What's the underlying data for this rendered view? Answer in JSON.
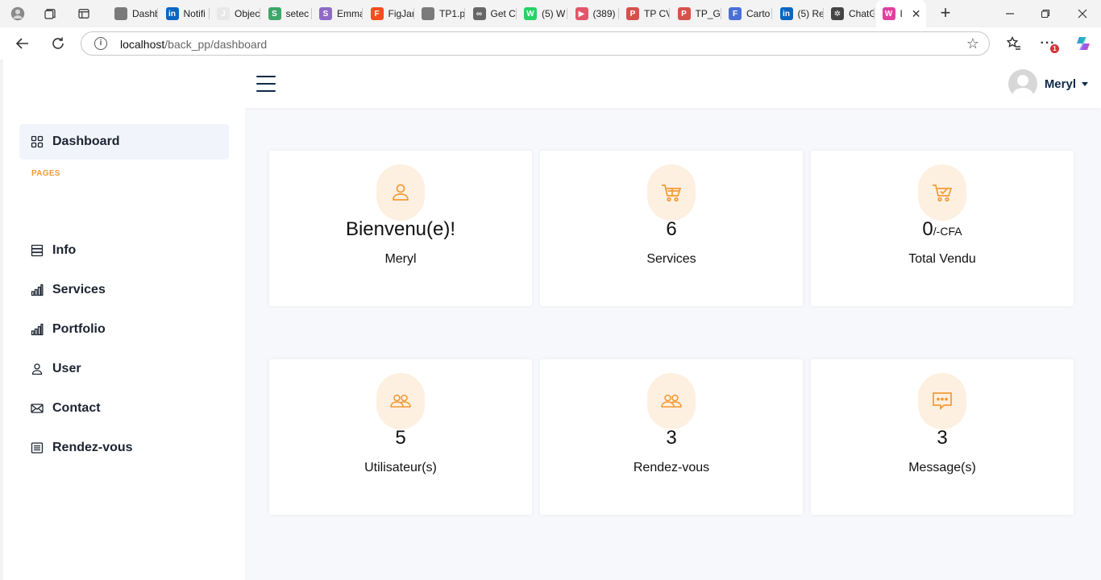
{
  "browser": {
    "tabs": [
      {
        "title": "Dashb",
        "color": "#7a7a7a",
        "glyph": ""
      },
      {
        "title": "Notifi",
        "color": "#0a66c2",
        "glyph": "in"
      },
      {
        "title": "Objec",
        "color": "#e8e8e8",
        "glyph": "J"
      },
      {
        "title": "setec",
        "color": "#3fa66a",
        "glyph": "S"
      },
      {
        "title": "Emma",
        "color": "#8e6ac6",
        "glyph": "S"
      },
      {
        "title": "FigJar",
        "color": "#f24e1e",
        "glyph": "F"
      },
      {
        "title": "TP1.p",
        "color": "#7a7a7a",
        "glyph": ""
      },
      {
        "title": "Get C",
        "color": "#666666",
        "glyph": "∞"
      },
      {
        "title": "(5) W",
        "color": "#25d366",
        "glyph": "W"
      },
      {
        "title": "(389)",
        "color": "#e2566a",
        "glyph": "▶"
      },
      {
        "title": "TP CV",
        "color": "#d6504c",
        "glyph": "P"
      },
      {
        "title": "TP_G",
        "color": "#d6504c",
        "glyph": "P"
      },
      {
        "title": "Carto",
        "color": "#4a6fd8",
        "glyph": "F"
      },
      {
        "title": "(5) Re",
        "color": "#0a66c2",
        "glyph": "in"
      },
      {
        "title": "ChatG",
        "color": "#444444",
        "glyph": "✲"
      },
      {
        "title": "I",
        "color": "#e040a0",
        "glyph": "W"
      }
    ],
    "new_tab_label": "+",
    "url_host": "localhost",
    "url_path": "/back_pp/dashboard",
    "notification_count": "1"
  },
  "app": {
    "user_name": "Meryl",
    "sidebar": {
      "dashboard": "Dashboard",
      "section_pages": "PAGES",
      "items": [
        "Info",
        "Services",
        "Portfolio",
        "User",
        "Contact",
        "Rendez-vous"
      ]
    },
    "cards": [
      {
        "icon": "user-icon",
        "value": "Bienvenu(e)!",
        "unit": "",
        "caption": "Meryl"
      },
      {
        "icon": "cart-icon",
        "value": "6",
        "unit": "",
        "caption": "Services"
      },
      {
        "icon": "cart-check-icon",
        "value": "0",
        "unit": "/-CFA",
        "caption": "Total Vendu"
      },
      {
        "icon": "users-icon",
        "value": "5",
        "unit": "",
        "caption": "Utilisateur(s)"
      },
      {
        "icon": "users-icon",
        "value": "3",
        "unit": "",
        "caption": "Rendez-vous"
      },
      {
        "icon": "message-icon",
        "value": "3",
        "unit": "",
        "caption": "Message(s)"
      }
    ]
  },
  "colors": {
    "accent": "#f29a36",
    "navy": "#0e2a47",
    "icon_circle": "#fdf0e1"
  }
}
